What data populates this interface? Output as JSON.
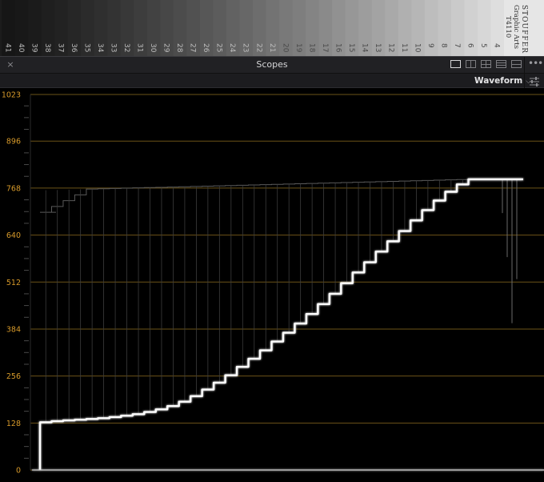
{
  "viewer": {
    "step_numbers": [
      "41",
      "40",
      "39",
      "38",
      "37",
      "36",
      "35",
      "34",
      "33",
      "32",
      "31",
      "30",
      "29",
      "28",
      "27",
      "26",
      "25",
      "24",
      "23",
      "22",
      "21",
      "20",
      "19",
      "18",
      "17",
      "16",
      "15",
      "14",
      "13",
      "12",
      "11",
      "10",
      "9",
      "8",
      "7",
      "6",
      "5",
      "4"
    ],
    "chart_label": [
      "STOUFFER",
      "Graphic Arts",
      "T4110"
    ]
  },
  "header": {
    "title": "Scopes",
    "close_glyph": "×",
    "more_glyph": "•••"
  },
  "toolbar": {
    "scope_type": "Waveform",
    "chevron_glyph": "⌵"
  },
  "chart_data": {
    "type": "line",
    "title": "",
    "xlabel": "",
    "ylabel": "",
    "ylim": [
      0,
      1023
    ],
    "y_ticks": [
      0,
      128,
      256,
      384,
      512,
      640,
      768,
      896,
      1023
    ],
    "tick_labels": [
      "0",
      "128",
      "256",
      "384",
      "512",
      "640",
      "768",
      "896",
      "1023"
    ],
    "grid": true,
    "series": [
      {
        "steps": [
          130,
          133,
          135,
          137,
          139,
          141,
          144,
          148,
          152,
          158,
          165,
          174,
          186,
          201,
          219,
          238,
          258,
          281,
          303,
          326,
          350,
          374,
          399,
          425,
          452,
          480,
          509,
          538,
          566,
          595,
          623,
          651,
          680,
          708,
          734,
          758,
          778,
          792
        ],
        "plateau": 792,
        "highlights": 762
      }
    ],
    "colors": {
      "trace": "#ffffff",
      "grid": "#6b5318",
      "tick_label": "#d79a2a",
      "background": "#000000"
    }
  }
}
